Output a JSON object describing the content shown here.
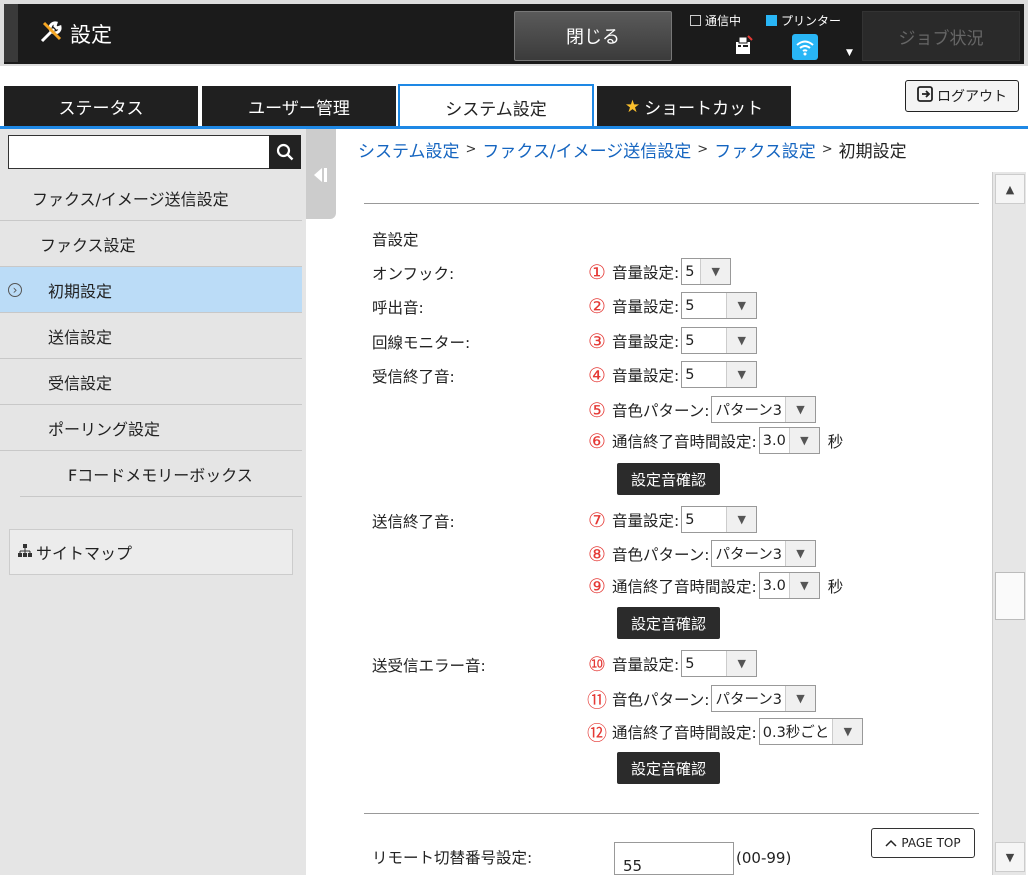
{
  "header": {
    "title": "設定",
    "close_label": "閉じる",
    "status_comm": "通信中",
    "status_printer": "プリンター",
    "job_status": "ジョブ状況",
    "logout": "ログアウト"
  },
  "tabs": [
    "ステータス",
    "ユーザー管理",
    "システム設定",
    "ショートカット"
  ],
  "sidebar": {
    "search_placeholder": "",
    "items": [
      "ファクス/イメージ送信設定",
      "ファクス設定",
      "初期設定",
      "送信設定",
      "受信設定",
      "ポーリング設定",
      "Fコードメモリーボックス"
    ],
    "sitemap": "サイトマップ"
  },
  "breadcrumb": {
    "items": [
      "システム設定",
      "ファクス/イメージ送信設定",
      "ファクス設定",
      "初期設定"
    ],
    "sep": ">"
  },
  "content": {
    "section": "音設定",
    "labels": {
      "onhook": "オンフック:",
      "ring": "呼出音:",
      "line_monitor": "回線モニター:",
      "rx_end": "受信終了音:",
      "tx_end": "送信終了音:",
      "error": "送受信エラー音:"
    },
    "rows": [
      {
        "num": "①",
        "label": "音量設定:",
        "value": "5"
      },
      {
        "num": "②",
        "label": "音量設定:",
        "value": "5"
      },
      {
        "num": "③",
        "label": "音量設定:",
        "value": "5"
      },
      {
        "num": "④",
        "label": "音量設定:",
        "value": "5"
      },
      {
        "num": "⑤",
        "label": "音色パターン:",
        "value": "パターン3"
      },
      {
        "num": "⑥",
        "label": "通信終了音時間設定:",
        "value": "3.0",
        "unit": "秒"
      },
      {
        "num": "⑦",
        "label": "音量設定:",
        "value": "5"
      },
      {
        "num": "⑧",
        "label": "音色パターン:",
        "value": "パターン3"
      },
      {
        "num": "⑨",
        "label": "通信終了音時間設定:",
        "value": "3.0",
        "unit": "秒"
      },
      {
        "num": "⑩",
        "label": "音量設定:",
        "value": "5"
      },
      {
        "num": "⑪",
        "label": "音色パターン:",
        "value": "パターン3"
      },
      {
        "num": "⑫",
        "label": "通信終了音時間設定:",
        "value": "0.3秒ごと"
      }
    ],
    "confirm_btn": "設定音確認",
    "remote_label": "リモート切替番号設定:",
    "remote_value": "55",
    "remote_range": "(00-99)",
    "page_top": "PAGE TOP"
  },
  "colors": {
    "accent": "#1e88e5",
    "number": "#e53935",
    "active_nav": "#bbdcf7"
  }
}
